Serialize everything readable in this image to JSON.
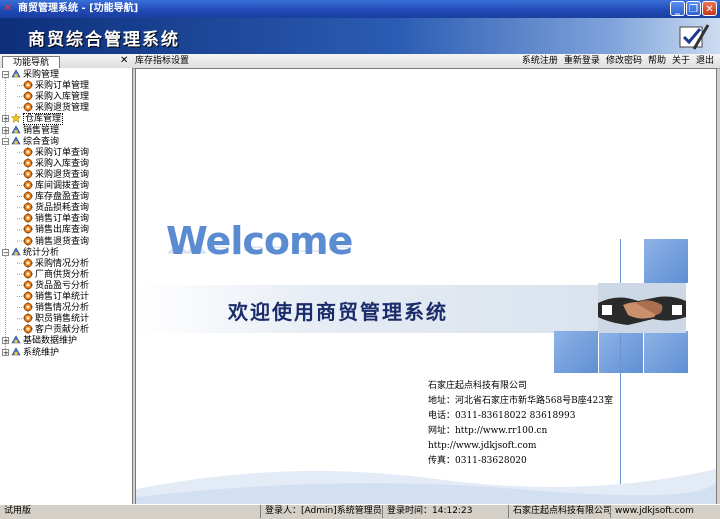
{
  "window": {
    "title": "商贸管理系统 - [功能导航]"
  },
  "banner": {
    "title": "商贸综合管理系统"
  },
  "toolbar": {
    "nav_tab": "功能导航",
    "page_title": "库存指标设置",
    "links": [
      "系统注册",
      "重新登录",
      "修改密码",
      "帮助",
      "关于",
      "退出"
    ]
  },
  "tree": {
    "nodes": [
      {
        "label": "采购管理",
        "level": 0,
        "expanded": true,
        "icon": "folder-icon"
      },
      {
        "label": "采购订单管理",
        "level": 1,
        "icon": "gear-icon"
      },
      {
        "label": "采购入库管理",
        "level": 1,
        "icon": "gear-icon"
      },
      {
        "label": "采购退货管理",
        "level": 1,
        "icon": "gear-icon"
      },
      {
        "label": "仓库管理",
        "level": 0,
        "expanded": false,
        "selected": true,
        "icon": "star-icon"
      },
      {
        "label": "销售管理",
        "level": 0,
        "expanded": false,
        "icon": "folder-icon"
      },
      {
        "label": "综合查询",
        "level": 0,
        "expanded": true,
        "icon": "folder-icon"
      },
      {
        "label": "采购订单查询",
        "level": 1,
        "icon": "gear-icon"
      },
      {
        "label": "采购入库查询",
        "level": 1,
        "icon": "gear-icon"
      },
      {
        "label": "采购退货查询",
        "level": 1,
        "icon": "gear-icon"
      },
      {
        "label": "库间调拨查询",
        "level": 1,
        "icon": "gear-icon"
      },
      {
        "label": "库存盘盈查询",
        "level": 1,
        "icon": "gear-icon"
      },
      {
        "label": "货品损耗查询",
        "level": 1,
        "icon": "gear-icon"
      },
      {
        "label": "销售订单查询",
        "level": 1,
        "icon": "gear-icon"
      },
      {
        "label": "销售出库查询",
        "level": 1,
        "icon": "gear-icon"
      },
      {
        "label": "销售退货查询",
        "level": 1,
        "icon": "gear-icon"
      },
      {
        "label": "统计分析",
        "level": 0,
        "expanded": true,
        "icon": "folder-icon"
      },
      {
        "label": "采购情况分析",
        "level": 1,
        "icon": "gear-icon"
      },
      {
        "label": "厂商供货分析",
        "level": 1,
        "icon": "gear-icon"
      },
      {
        "label": "货品盈亏分析",
        "level": 1,
        "icon": "gear-icon"
      },
      {
        "label": "销售订单统计",
        "level": 1,
        "icon": "gear-icon"
      },
      {
        "label": "销售情况分析",
        "level": 1,
        "icon": "gear-icon"
      },
      {
        "label": "职员销售统计",
        "level": 1,
        "icon": "gear-icon"
      },
      {
        "label": "客户贡献分析",
        "level": 1,
        "icon": "gear-icon"
      },
      {
        "label": "基础数据维护",
        "level": 0,
        "expanded": false,
        "icon": "folder-icon"
      },
      {
        "label": "系统维护",
        "level": 0,
        "expanded": false,
        "icon": "folder-icon"
      }
    ]
  },
  "main": {
    "welcome": "Welcome",
    "slogan": "欢迎使用商贸管理系统",
    "company": [
      "石家庄起点科技有限公司",
      "地址：河北省石家庄市新华路568号B座423室",
      "电话：0311-83618022  83618993",
      "网址：http://www.rr100.cn",
      "http://www.jdkjsoft.com",
      "传真：0311-83628020"
    ]
  },
  "status": {
    "edition": "试用版",
    "login_user": "登录人：[Admin]系统管理员",
    "login_time": "登录时间：14:12:23",
    "company": "石家庄起点科技有限公司",
    "website": "www.jdkjsoft.com"
  },
  "colors": {
    "accent": "#2b5cb3",
    "square": "#6f9bdc"
  }
}
